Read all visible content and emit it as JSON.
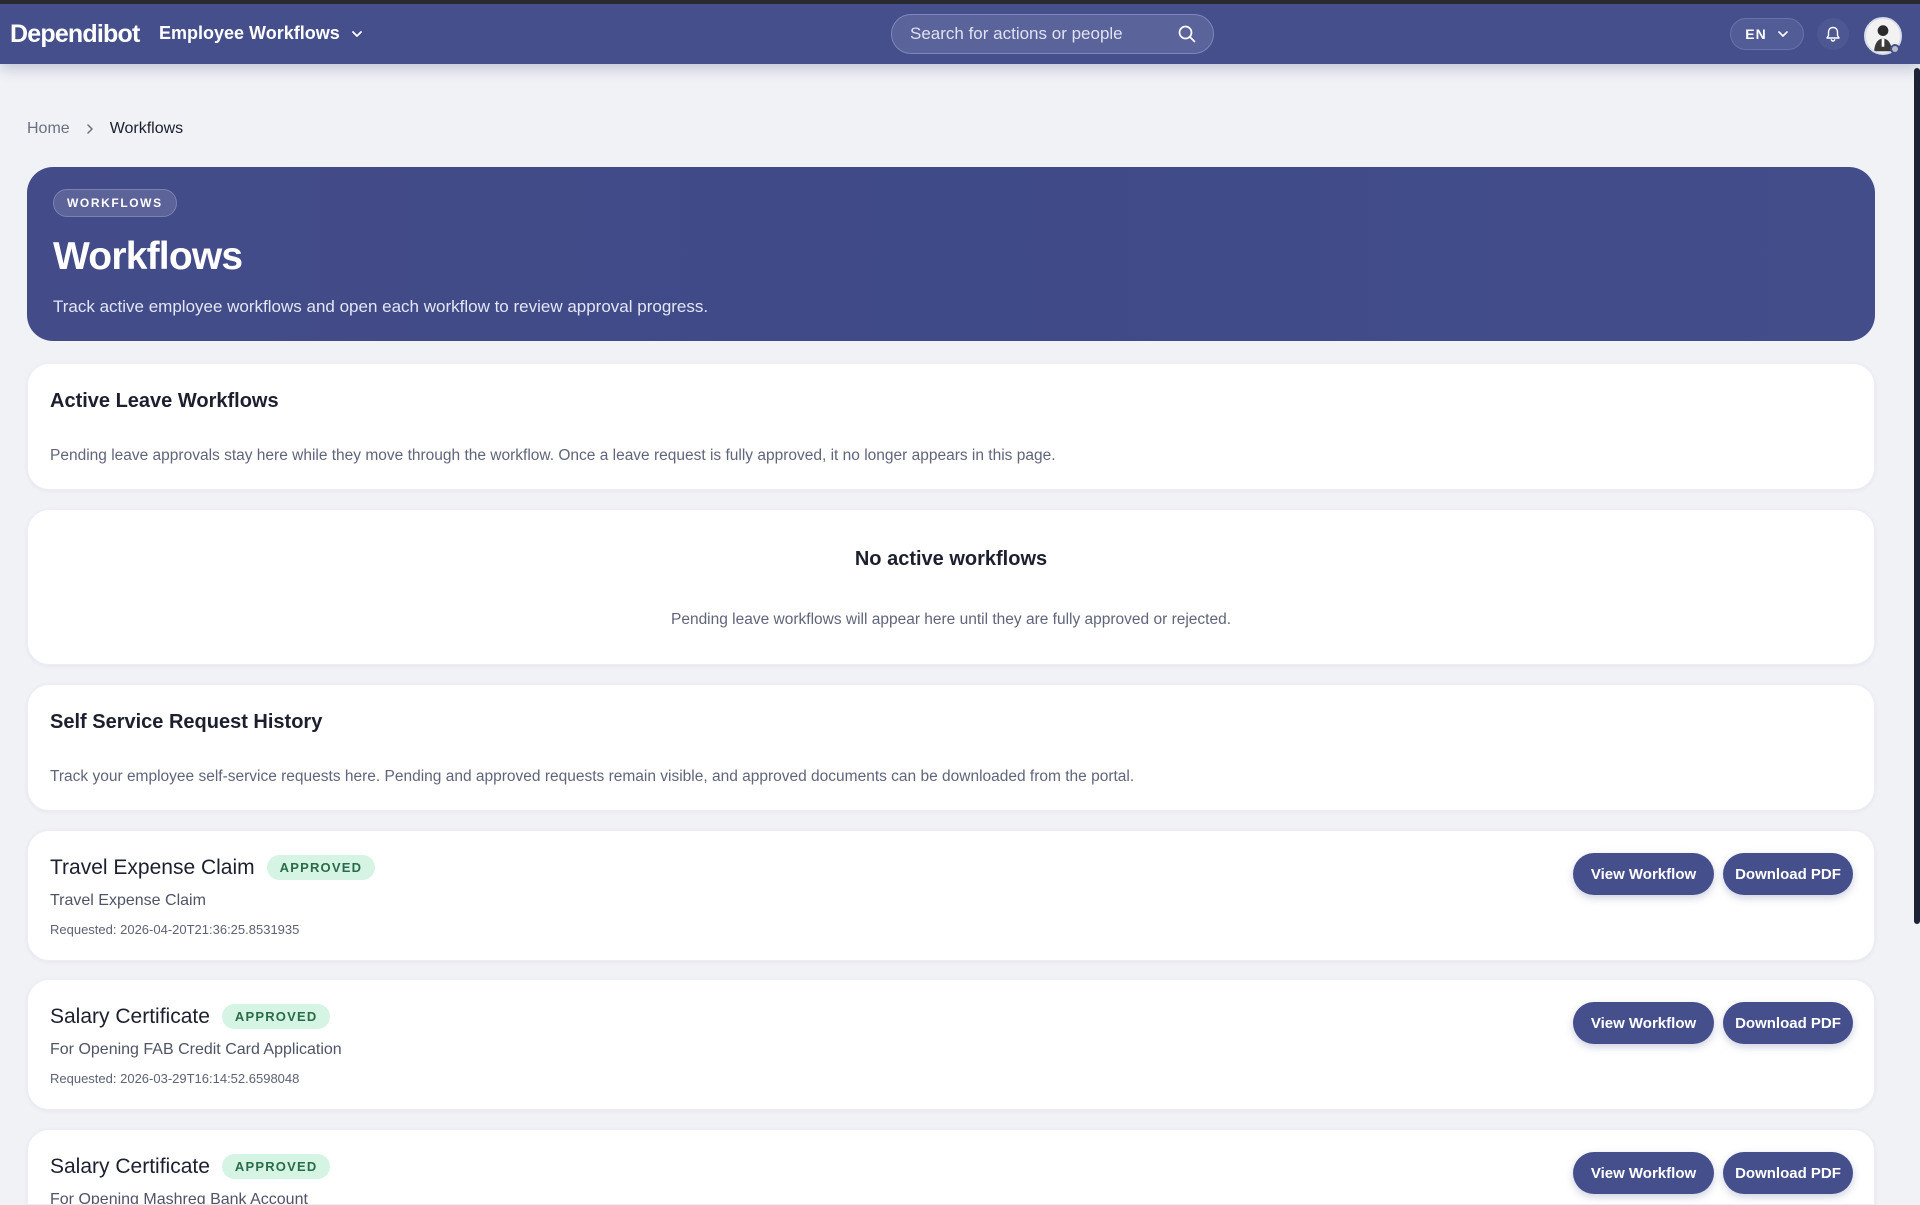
{
  "nav": {
    "brand": "Dependibot",
    "module": "Employee Workflows",
    "search_placeholder": "Search for actions or people",
    "language": "EN"
  },
  "breadcrumb": {
    "home": "Home",
    "current": "Workflows"
  },
  "hero": {
    "tag": "WORKFLOWS",
    "title": "Workflows",
    "subtitle": "Track active employee workflows and open each workflow to review approval progress."
  },
  "leave_section": {
    "title": "Active Leave Workflows",
    "description": "Pending leave approvals stay here while they move through the workflow. Once a leave request is fully approved, it no longer appears in this page."
  },
  "empty_state": {
    "title": "No active workflows",
    "description": "Pending leave workflows will appear here until they are fully approved or rejected."
  },
  "history_section": {
    "title": "Self Service Request History",
    "description": "Track your employee self-service requests here. Pending and approved requests remain visible, and approved documents can be downloaded from the portal."
  },
  "requests": [
    {
      "title": "Travel Expense Claim",
      "status": "APPROVED",
      "subtitle": "Travel Expense Claim",
      "requested": "Requested: 2026-04-20T21:36:25.8531935",
      "view_label": "View Workflow",
      "download_label": "Download PDF"
    },
    {
      "title": "Salary Certificate",
      "status": "APPROVED",
      "subtitle": "For Opening FAB Credit Card Application",
      "requested": "Requested: 2026-03-29T16:14:52.6598048",
      "view_label": "View Workflow",
      "download_label": "Download PDF"
    },
    {
      "title": "Salary Certificate",
      "status": "APPROVED",
      "subtitle": "For Opening Mashreq Bank Account",
      "requested": "",
      "view_label": "View Workflow",
      "download_label": "Download PDF"
    }
  ],
  "colors": {
    "brand": "#454f8b",
    "approved_badge_bg": "#d5f4e4",
    "approved_badge_text": "#2a6b4a",
    "page_bg": "#f1f2f6"
  },
  "icons": {
    "search": "search-icon",
    "chevron": "chevron-down-icon",
    "bell": "bell-icon",
    "breadcrumb_separator": "chevron-right-icon"
  }
}
